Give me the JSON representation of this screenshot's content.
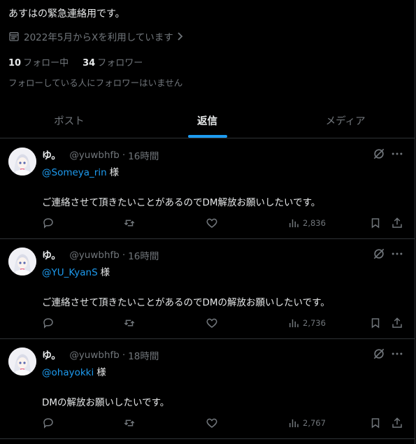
{
  "profile": {
    "bio": "あすはの緊急連絡用です。",
    "joined": "2022年5月からXを利用しています",
    "following_count": "10",
    "following_label": "フォロー中",
    "followers_count": "34",
    "followers_label": "フォロワー",
    "no_mutual_followers": "フォローしている人にフォロワーはいません"
  },
  "tabs": [
    {
      "label": "ポスト",
      "active": false
    },
    {
      "label": "返信",
      "active": true
    },
    {
      "label": "メディア",
      "active": false
    }
  ],
  "accent_color": "#1d9bf0",
  "icons": [
    "calendar-icon",
    "chevron-right-icon",
    "grok-icon",
    "more-icon",
    "reply-icon",
    "repost-icon",
    "like-icon",
    "views-icon",
    "bookmark-icon",
    "share-icon"
  ],
  "tweets": [
    {
      "name": "ゆ。",
      "handle": "@yuwbhfb",
      "dot": "·",
      "time": "16時間",
      "mention": "@Someya_rin",
      "honorific": "様",
      "text": "ご連絡させて頂きたいことがあるのでDM解放お願いしたいです。",
      "views": "2,836"
    },
    {
      "name": "ゆ。",
      "handle": "@yuwbhfb",
      "dot": "·",
      "time": "16時間",
      "mention": "@YU_KyanS",
      "honorific": "様",
      "text": "ご連絡させて頂きたいことがあるのでDMの解放お願いしたいです。",
      "views": "2,736"
    },
    {
      "name": "ゆ。",
      "handle": "@yuwbhfb",
      "dot": "·",
      "time": "18時間",
      "mention": "@ohayokki",
      "honorific": "様",
      "text": "DMの解放お願いしたいです。",
      "views": "2,767"
    }
  ]
}
